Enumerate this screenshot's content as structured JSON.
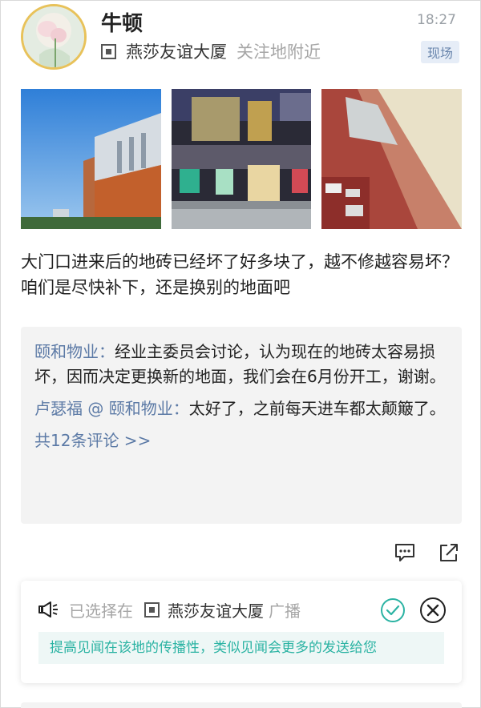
{
  "post": {
    "username": "牛顿",
    "time": "18:27",
    "location_name": "燕莎友谊大厦",
    "location_sub": "关注地附近",
    "tag": "现场",
    "text": "大门口进来后的地砖已经坏了好多块了，越不修越容易坏？咱们是尽快补下，还是换别的地面吧"
  },
  "comments": [
    {
      "author": "颐和物业：",
      "text": "经业主委员会讨论，认为现在的地砖太容易损坏，因而决定更换新的地面，我们会在6月份开工，谢谢。"
    },
    {
      "author": "卢瑟福 @ 颐和物业：",
      "text": "太好了，之前每天进车都太颠簸了。"
    }
  ],
  "comments_more": "共12条评论 >>",
  "broadcast": {
    "prefix": "已选择在",
    "location": "燕莎友谊大厦",
    "suffix": "广播",
    "hint": "提高见闻在该地的传播性，类似见闻会更多的发送给您"
  },
  "colors": {
    "link": "#5c7aa6",
    "accent_green": "#2bb3a3",
    "tag_bg": "#e6edf7"
  },
  "icons": {
    "comment": "comment-icon",
    "share": "share-icon",
    "speaker": "megaphone-icon",
    "confirm": "check-circle-icon",
    "close": "close-circle-icon"
  }
}
